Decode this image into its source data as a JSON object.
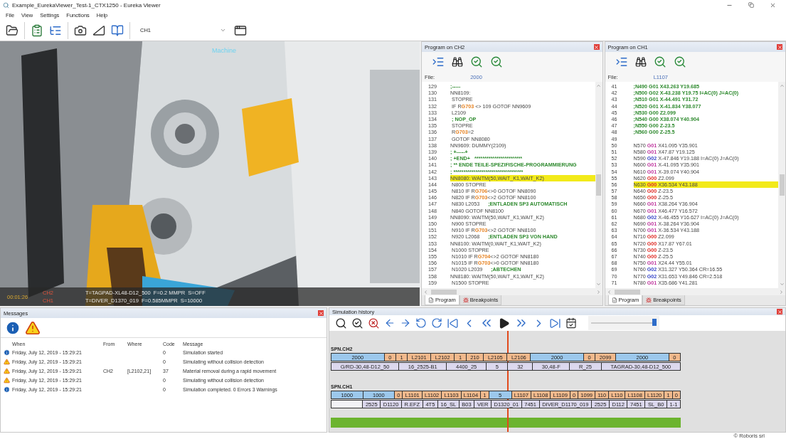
{
  "window": {
    "title": "Example_EurekaViewer_Test-1_CTX1250 - Eureka Viewer"
  },
  "menu": [
    "File",
    "View",
    "Settings",
    "Functions",
    "Help"
  ],
  "toolbar": {
    "channel_select": "CH1"
  },
  "viewport": {
    "label": "Machine",
    "overlay": {
      "time": "00:01:26",
      "channels": [
        {
          "name": "CH2",
          "info": "T=TAGPAD-XL48-D12_500  F=0.2 MMPR  S=OFF"
        },
        {
          "name": "CH1",
          "info": "T=DIVER_D1370_019  F=0.585MMPR  S=10000"
        }
      ]
    }
  },
  "programs": [
    {
      "title": "Program on CH2",
      "file_label": "File:",
      "file": "2000",
      "lines": [
        {
          "n": "129",
          "highlighted": false,
          "parts": [
            {
              "kind": "comment",
              "text": ";-----"
            }
          ]
        },
        {
          "n": "130",
          "highlighted": false,
          "parts": [
            {
              "kind": "plain",
              "text": "NN8109:"
            }
          ]
        },
        {
          "n": "131",
          "highlighted": false,
          "parts": [
            {
              "kind": "plain",
              "text": " STOPRE"
            }
          ]
        },
        {
          "n": "132",
          "highlighted": false,
          "parts": [
            {
              "kind": "plain",
              "text": " IF R"
            },
            {
              "kind": "register",
              "text": "G703"
            },
            {
              "kind": "plain",
              "text": " <> 109 GOTOF NN9609"
            }
          ]
        },
        {
          "n": "133",
          "highlighted": false,
          "parts": [
            {
              "kind": "plain",
              "text": " L2109"
            }
          ]
        },
        {
          "n": "134",
          "highlighted": false,
          "parts": [
            {
              "kind": "comment",
              "text": " ; NOP_OP"
            }
          ]
        },
        {
          "n": "135",
          "highlighted": false,
          "parts": [
            {
              "kind": "plain",
              "text": " STOPRE"
            }
          ]
        },
        {
          "n": "136",
          "highlighted": false,
          "parts": [
            {
              "kind": "plain",
              "text": " R"
            },
            {
              "kind": "register",
              "text": "G703"
            },
            {
              "kind": "plain",
              "text": "=2"
            }
          ]
        },
        {
          "n": "137",
          "highlighted": false,
          "parts": [
            {
              "kind": "plain",
              "text": " GOTOF NN8080"
            }
          ]
        },
        {
          "n": "138",
          "highlighted": false,
          "parts": [
            {
              "kind": "plain",
              "text": "NN9609: DUMMY(2109)"
            }
          ]
        },
        {
          "n": "139",
          "highlighted": false,
          "parts": [
            {
              "kind": "comment",
              "text": "; +-----+"
            }
          ]
        },
        {
          "n": "140",
          "highlighted": false,
          "parts": [
            {
              "kind": "comment",
              "text": "; +END+   ************************"
            }
          ]
        },
        {
          "n": "141",
          "highlighted": false,
          "parts": [
            {
              "kind": "comment",
              "text": "; ** ENDE TEILE-SPEZIFISCHE-PROGRAMMIERUNG"
            }
          ]
        },
        {
          "n": "142",
          "highlighted": false,
          "parts": [
            {
              "kind": "comment",
              "text": "; ***********************************"
            }
          ]
        },
        {
          "n": "143",
          "highlighted": true,
          "parts": [
            {
              "kind": "plain",
              "text": "NN8080: WAITM(50,WAIT_K1,WAIT_K2)"
            }
          ]
        },
        {
          "n": "144",
          "highlighted": false,
          "parts": [
            {
              "kind": "plain",
              "text": " N800 STOPRE"
            }
          ]
        },
        {
          "n": "145",
          "highlighted": false,
          "parts": [
            {
              "kind": "plain",
              "text": " N810 IF R"
            },
            {
              "kind": "register",
              "text": "G706"
            },
            {
              "kind": "plain",
              "text": "<>0 GOTOF NN8090"
            }
          ]
        },
        {
          "n": "146",
          "highlighted": false,
          "parts": [
            {
              "kind": "plain",
              "text": " N820 IF R"
            },
            {
              "kind": "register",
              "text": "G703"
            },
            {
              "kind": "plain",
              "text": "<>2 GOTOF NN8100"
            }
          ]
        },
        {
          "n": "147",
          "highlighted": false,
          "parts": [
            {
              "kind": "plain",
              "text": " N830 L2053      "
            },
            {
              "kind": "comment",
              "text": ";ENTLADEN SP3 AUTOMATISCH"
            }
          ]
        },
        {
          "n": "148",
          "highlighted": false,
          "parts": [
            {
              "kind": "plain",
              "text": " N840 GOTOF NN8100"
            }
          ]
        },
        {
          "n": "149",
          "highlighted": false,
          "parts": [
            {
              "kind": "plain",
              "text": "NN8090: WAITM(50,WAIT_K1,WAIT_K2)"
            }
          ]
        },
        {
          "n": "150",
          "highlighted": false,
          "parts": [
            {
              "kind": "plain",
              "text": " N900 STOPRE"
            }
          ]
        },
        {
          "n": "151",
          "highlighted": false,
          "parts": [
            {
              "kind": "plain",
              "text": " N910 IF R"
            },
            {
              "kind": "register",
              "text": "G703"
            },
            {
              "kind": "plain",
              "text": "<>2 GOTOF NN8100"
            }
          ]
        },
        {
          "n": "152",
          "highlighted": false,
          "parts": [
            {
              "kind": "plain",
              "text": " N920 L2068      "
            },
            {
              "kind": "comment",
              "text": ";ENTLADEN SP3 VON HAND"
            }
          ]
        },
        {
          "n": "153",
          "highlighted": false,
          "parts": [
            {
              "kind": "plain",
              "text": "NN8100: WAITM(0,WAIT_K1,WAIT_K2)"
            }
          ]
        },
        {
          "n": "154",
          "highlighted": false,
          "parts": [
            {
              "kind": "plain",
              "text": " N1000 STOPRE"
            }
          ]
        },
        {
          "n": "155",
          "highlighted": false,
          "parts": [
            {
              "kind": "plain",
              "text": " N1010 IF R"
            },
            {
              "kind": "register",
              "text": "G704"
            },
            {
              "kind": "plain",
              "text": "<>2 GOTOF NN8180"
            }
          ]
        },
        {
          "n": "156",
          "highlighted": false,
          "parts": [
            {
              "kind": "plain",
              "text": " N1015 IF R"
            },
            {
              "kind": "register",
              "text": "G703"
            },
            {
              "kind": "plain",
              "text": "<>0 GOTOF NN8180"
            }
          ]
        },
        {
          "n": "157",
          "highlighted": false,
          "parts": [
            {
              "kind": "plain",
              "text": " N1020 L2039      "
            },
            {
              "kind": "comment",
              "text": ";ABTECHEN"
            }
          ]
        },
        {
          "n": "158",
          "highlighted": false,
          "parts": [
            {
              "kind": "plain",
              "text": "NN8180: WAITM(50,WAIT_K1,WAIT_K2)"
            }
          ]
        },
        {
          "n": "159",
          "highlighted": false,
          "parts": [
            {
              "kind": "plain",
              "text": " N1500 STOPRE"
            }
          ]
        }
      ],
      "tabs": [
        {
          "label": "Program",
          "selected": true
        },
        {
          "label": "Breakpoints",
          "selected": false
        }
      ]
    },
    {
      "title": "Program on CH1",
      "file_label": "File:",
      "file": "L1107",
      "lines": [
        {
          "n": "41",
          "highlighted": false,
          "parts": [
            {
              "kind": "comment",
              "text": ";N490 G01 X43.263 Y19.685"
            }
          ]
        },
        {
          "n": "42",
          "highlighted": false,
          "parts": [
            {
              "kind": "comment",
              "text": ";N500 G02 X-43.238 Y19.75 I=AC(0) J=AC(0)"
            }
          ]
        },
        {
          "n": "43",
          "highlighted": false,
          "parts": [
            {
              "kind": "comment",
              "text": ";N510 G01 X-44.491 Y31.72"
            }
          ]
        },
        {
          "n": "44",
          "highlighted": false,
          "parts": [
            {
              "kind": "comment",
              "text": ";N520 G01 X-41.834 Y38.077"
            }
          ]
        },
        {
          "n": "45",
          "highlighted": false,
          "parts": [
            {
              "kind": "comment",
              "text": ";N530 G00 Z2.099"
            }
          ]
        },
        {
          "n": "46",
          "highlighted": false,
          "parts": [
            {
              "kind": "comment",
              "text": ";N540 G00 X38.074 Y40.904"
            }
          ]
        },
        {
          "n": "47",
          "highlighted": false,
          "parts": [
            {
              "kind": "comment",
              "text": ";N550 G00 Z-23.5"
            }
          ]
        },
        {
          "n": "48",
          "highlighted": false,
          "parts": [
            {
              "kind": "comment",
              "text": ";N560 G00 Z-25.5"
            }
          ]
        },
        {
          "n": "49",
          "highlighted": false
        },
        {
          "n": "50",
          "highlighted": false,
          "parts": [
            {
              "kind": "plain",
              "text": "N570 "
            },
            {
              "kind": "g01",
              "text": "G01"
            },
            {
              "kind": "plain",
              "text": " X41.095 Y35.901"
            }
          ]
        },
        {
          "n": "51",
          "highlighted": false,
          "parts": [
            {
              "kind": "plain",
              "text": "N580 "
            },
            {
              "kind": "g01",
              "text": "G01"
            },
            {
              "kind": "plain",
              "text": " X47.87 Y19.125"
            }
          ]
        },
        {
          "n": "52",
          "highlighted": false,
          "parts": [
            {
              "kind": "plain",
              "text": "N590 "
            },
            {
              "kind": "g02",
              "text": "G02"
            },
            {
              "kind": "plain",
              "text": " X-47.846 Y19.188 I=AC(0) J=AC(0)"
            }
          ]
        },
        {
          "n": "53",
          "highlighted": false,
          "parts": [
            {
              "kind": "plain",
              "text": "N600 "
            },
            {
              "kind": "g01",
              "text": "G01"
            },
            {
              "kind": "plain",
              "text": " X-41.095 Y35.901"
            }
          ]
        },
        {
          "n": "54",
          "highlighted": false,
          "parts": [
            {
              "kind": "plain",
              "text": "N610 "
            },
            {
              "kind": "g01",
              "text": "G01"
            },
            {
              "kind": "plain",
              "text": " X-39.074 Y40.904"
            }
          ]
        },
        {
          "n": "55",
          "highlighted": false,
          "parts": [
            {
              "kind": "plain",
              "text": "N620 "
            },
            {
              "kind": "g00",
              "text": "G00"
            },
            {
              "kind": "plain",
              "text": " Z2.099"
            }
          ]
        },
        {
          "n": "56",
          "highlighted": true,
          "parts": [
            {
              "kind": "plain",
              "text": "N630 "
            },
            {
              "kind": "g00",
              "text": "G00"
            },
            {
              "kind": "plain",
              "text": " X36.534 Y43.188"
            }
          ]
        },
        {
          "n": "57",
          "highlighted": false,
          "parts": [
            {
              "kind": "plain",
              "text": "N640 "
            },
            {
              "kind": "g00",
              "text": "G00"
            },
            {
              "kind": "plain",
              "text": " Z-23.5"
            }
          ]
        },
        {
          "n": "58",
          "highlighted": false,
          "parts": [
            {
              "kind": "plain",
              "text": "N650 "
            },
            {
              "kind": "g00",
              "text": "G00"
            },
            {
              "kind": "plain",
              "text": " Z-25.5"
            }
          ]
        },
        {
          "n": "59",
          "highlighted": false,
          "parts": [
            {
              "kind": "plain",
              "text": "N660 "
            },
            {
              "kind": "g01",
              "text": "G01"
            },
            {
              "kind": "plain",
              "text": " X38.264 Y36.904"
            }
          ]
        },
        {
          "n": "60",
          "highlighted": false,
          "parts": [
            {
              "kind": "plain",
              "text": "N670 "
            },
            {
              "kind": "g01",
              "text": "G01"
            },
            {
              "kind": "plain",
              "text": " X46.477 Y16.572"
            }
          ]
        },
        {
          "n": "61",
          "highlighted": false,
          "parts": [
            {
              "kind": "plain",
              "text": "N680 "
            },
            {
              "kind": "g02",
              "text": "G02"
            },
            {
              "kind": "plain",
              "text": " X-46.455 Y16.627 I=AC(0) J=AC(0)"
            }
          ]
        },
        {
          "n": "62",
          "highlighted": false,
          "parts": [
            {
              "kind": "plain",
              "text": "N690 "
            },
            {
              "kind": "g01",
              "text": "G01"
            },
            {
              "kind": "plain",
              "text": " X-38.264 Y36.904"
            }
          ]
        },
        {
          "n": "63",
          "highlighted": false,
          "parts": [
            {
              "kind": "plain",
              "text": "N700 "
            },
            {
              "kind": "g01",
              "text": "G01"
            },
            {
              "kind": "plain",
              "text": " X-36.534 Y43.188"
            }
          ]
        },
        {
          "n": "64",
          "highlighted": false,
          "parts": [
            {
              "kind": "plain",
              "text": "N710 "
            },
            {
              "kind": "g00",
              "text": "G00"
            },
            {
              "kind": "plain",
              "text": " Z2.099"
            }
          ]
        },
        {
          "n": "65",
          "highlighted": false,
          "parts": [
            {
              "kind": "plain",
              "text": "N720 "
            },
            {
              "kind": "g00",
              "text": "G00"
            },
            {
              "kind": "plain",
              "text": " X17.87 Y67.01"
            }
          ]
        },
        {
          "n": "66",
          "highlighted": false,
          "parts": [
            {
              "kind": "plain",
              "text": "N730 "
            },
            {
              "kind": "g00",
              "text": "G00"
            },
            {
              "kind": "plain",
              "text": " Z-23.5"
            }
          ]
        },
        {
          "n": "67",
          "highlighted": false,
          "parts": [
            {
              "kind": "plain",
              "text": "N740 "
            },
            {
              "kind": "g00",
              "text": "G00"
            },
            {
              "kind": "plain",
              "text": " Z-25.5"
            }
          ]
        },
        {
          "n": "68",
          "highlighted": false,
          "parts": [
            {
              "kind": "plain",
              "text": "N750 "
            },
            {
              "kind": "g01",
              "text": "G01"
            },
            {
              "kind": "plain",
              "text": " X24.44 Y55.01"
            }
          ]
        },
        {
          "n": "69",
          "highlighted": false,
          "parts": [
            {
              "kind": "plain",
              "text": "N760 "
            },
            {
              "kind": "g02",
              "text": "G02"
            },
            {
              "kind": "plain",
              "text": " X31.327 Y50.364 CR=16.55"
            }
          ]
        },
        {
          "n": "70",
          "highlighted": false,
          "parts": [
            {
              "kind": "plain",
              "text": "N770 "
            },
            {
              "kind": "g02",
              "text": "G02"
            },
            {
              "kind": "plain",
              "text": " X31.653 Y49.846 CR=2.518"
            }
          ]
        },
        {
          "n": "71",
          "highlighted": false,
          "parts": [
            {
              "kind": "plain",
              "text": "N780 "
            },
            {
              "kind": "g01",
              "text": "G01"
            },
            {
              "kind": "plain",
              "text": " X35.686 Y41.281"
            }
          ]
        }
      ],
      "tabs": [
        {
          "label": "Program",
          "selected": true
        },
        {
          "label": "Breakpoints",
          "selected": false
        }
      ]
    }
  ],
  "messages": {
    "title": "Messages",
    "columns": [
      "When",
      "From",
      "Where",
      "Code",
      "Message"
    ],
    "rows": [
      {
        "kind": "info",
        "when": "Friday, July 12, 2019 - 15:29:21",
        "code": "0",
        "message": "Simulation started"
      },
      {
        "kind": "warning",
        "when": "Friday, July 12, 2019 - 15:29:21",
        "code": "0",
        "message": "Simulating without collision detection"
      },
      {
        "kind": "warning",
        "when": "Friday, July 12, 2019 - 15:29:21",
        "from": "CH2",
        "where": "[L2102,21]",
        "code": "37",
        "message": "Material removal during a rapid movement"
      },
      {
        "kind": "warning",
        "when": "Friday, July 12, 2019 - 15:29:21",
        "code": "0",
        "message": "Simulating without collision detection"
      },
      {
        "kind": "info",
        "when": "Friday, July 12, 2019 - 15:29:21",
        "code": "0",
        "message": "Simulation completed.  0 Errors  3 Warnings"
      }
    ]
  },
  "simulation_history": {
    "title": "Simulation history",
    "speed": {
      "level": 0.97
    },
    "progress": {
      "level": 0.77
    },
    "tracks": [
      {
        "name": "SPN.CH2",
        "programs": [
          {
            "kind": "prog",
            "label": "2000"
          },
          {
            "kind": "sub",
            "label": "0"
          },
          {
            "kind": "sub",
            "label": "1"
          },
          {
            "kind": "sub",
            "label": "L2101"
          },
          {
            "kind": "sub",
            "label": "L2102"
          },
          {
            "kind": "sub",
            "label": "1"
          },
          {
            "kind": "sub",
            "label": "210"
          },
          {
            "kind": "sub",
            "label": "L2105"
          },
          {
            "kind": "sub",
            "label": "L2106"
          },
          {
            "kind": "prog",
            "label": "2000"
          },
          {
            "kind": "sub",
            "label": "0"
          },
          {
            "kind": "sub",
            "label": "2099"
          },
          {
            "kind": "prog",
            "label": "2000"
          },
          {
            "kind": "sub",
            "label": "0"
          }
        ],
        "tools": [
          {
            "kind": "tool",
            "label": "G/RD-30,48-D12_50"
          },
          {
            "kind": "tool",
            "label": "16_2525-B1"
          },
          {
            "kind": "tool",
            "label": "4400_25"
          },
          {
            "kind": "tool",
            "label": "5"
          },
          {
            "kind": "tool",
            "label": "32"
          },
          {
            "kind": "tool",
            "label": "30,48-F"
          },
          {
            "kind": "tool",
            "label": "R_25"
          },
          {
            "kind": "tool",
            "label": "TAGRAD-30,48-D12_500"
          }
        ]
      },
      {
        "name": "SPN.CH1",
        "programs": [
          {
            "kind": "prog",
            "label": "1000"
          },
          {
            "kind": "prog",
            "label": "1000"
          },
          {
            "kind": "sub",
            "label": "0"
          },
          {
            "kind": "sub",
            "label": "L1101"
          },
          {
            "kind": "sub",
            "label": "L1102"
          },
          {
            "kind": "sub",
            "label": "L1103"
          },
          {
            "kind": "sub",
            "label": "L1104"
          },
          {
            "kind": "sub",
            "label": "1"
          },
          {
            "kind": "prog",
            "label": "5"
          },
          {
            "kind": "sub",
            "label": "L1107"
          },
          {
            "kind": "sub",
            "label": "L1108"
          },
          {
            "kind": "sub",
            "label": "L1109"
          },
          {
            "kind": "sub",
            "label": "0"
          },
          {
            "kind": "sub",
            "label": "1099"
          },
          {
            "kind": "sub",
            "label": "110"
          },
          {
            "kind": "sub",
            "label": "L110"
          },
          {
            "kind": "sub",
            "label": "L1108"
          },
          {
            "kind": "sub",
            "label": "L1120"
          },
          {
            "kind": "sub",
            "label": "1"
          },
          {
            "kind": "sub",
            "label": "0"
          }
        ],
        "tools": [
          {
            "kind": "gap"
          },
          {
            "kind": "tool",
            "label": "2525"
          },
          {
            "kind": "tool",
            "label": "D1120"
          },
          {
            "kind": "tool",
            "label": "R.EFZ"
          },
          {
            "kind": "tool",
            "label": "4T5"
          },
          {
            "kind": "tool",
            "label": "16_SL"
          },
          {
            "kind": "tool",
            "label": "B03"
          },
          {
            "kind": "tool",
            "label": "VER"
          },
          {
            "kind": "tool",
            "label": "D1320_01"
          },
          {
            "kind": "tool",
            "label": "7451"
          },
          {
            "kind": "tool",
            "label": "DIVER_D1170_019"
          },
          {
            "kind": "tool",
            "label": "2525"
          },
          {
            "kind": "tool",
            "label": "D112"
          },
          {
            "kind": "tool",
            "label": "7451"
          },
          {
            "kind": "tool",
            "label": "SL_B0"
          },
          {
            "kind": "tool",
            "label": "1-1"
          }
        ]
      }
    ]
  },
  "footer": "© Roboris srl"
}
